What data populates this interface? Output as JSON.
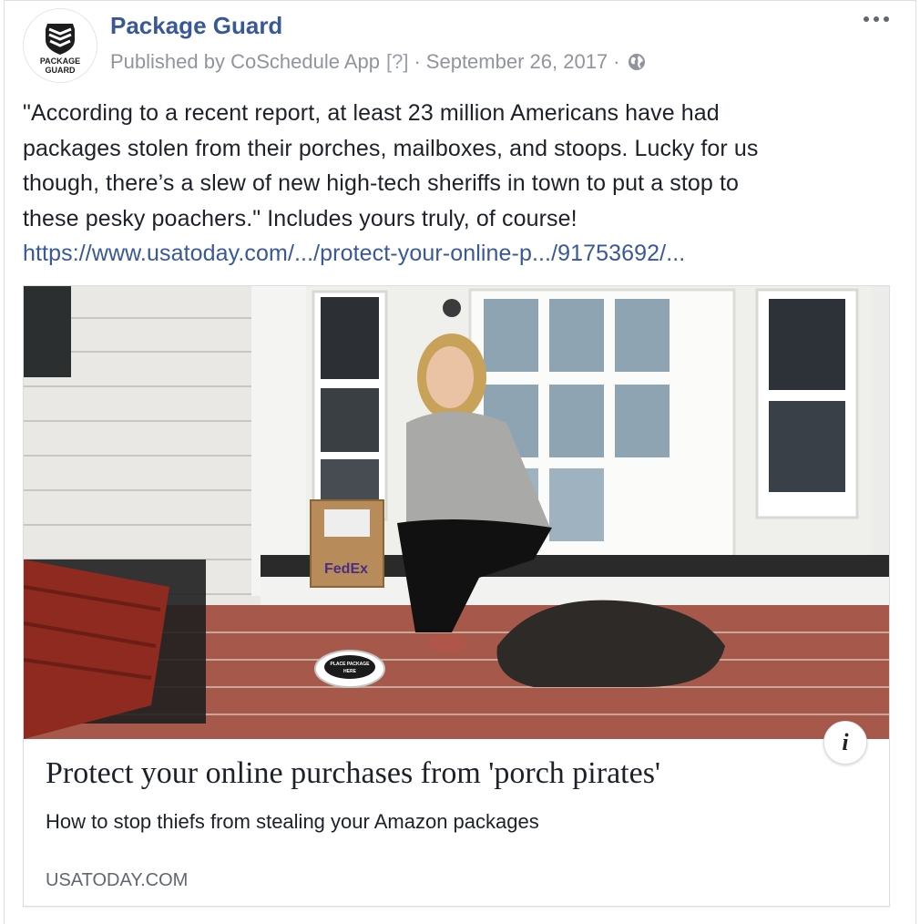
{
  "post": {
    "page_name": "Package Guard",
    "avatar_logo_text": [
      "PACKAGE",
      "GUARD"
    ],
    "meta": {
      "published_by": "Published by CoSchedule App",
      "help": "[?]",
      "separator": "·",
      "date": "September 26, 2017",
      "privacy_icon": "globe-icon"
    },
    "more_icon": "ellipsis-icon",
    "text_lines": [
      "\"According to a recent report, at least 23 million Americans have had",
      "packages stolen from their porches, mailboxes, and stoops. Lucky for us",
      "though, there’s a slew of new high-tech sheriffs in town to put a stop to",
      "these pesky poachers.\" Includes yours truly, of course!"
    ],
    "link": "https://www.usatoday.com/.../protect-your-online-p.../91753692/..."
  },
  "card": {
    "title": "Protect your online purchases from 'porch pirates'",
    "description": "How to stop thiefs from stealing your Amazon packages",
    "domain": "USATODAY.COM",
    "info_label": "i",
    "image_text": {
      "box_brand": "FedEx",
      "pad_top": "PLACE PACKAGE",
      "pad_bottom": "HERE"
    }
  },
  "colors": {
    "link": "#385898",
    "text": "#1d2129",
    "meta": "#90949c",
    "domain": "#606770",
    "border": "#dadde1"
  }
}
